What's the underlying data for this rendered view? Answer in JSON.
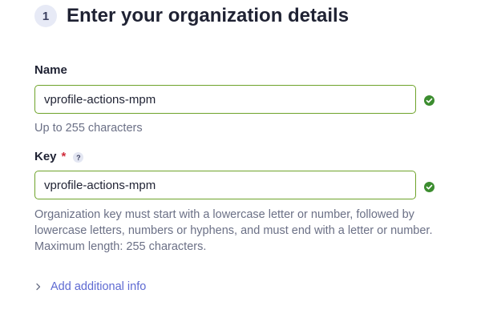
{
  "step": {
    "number": "1",
    "title": "Enter your organization details"
  },
  "name_field": {
    "label": "Name",
    "value": "vprofile-actions-mpm",
    "hint": "Up to 255 characters"
  },
  "key_field": {
    "label": "Key",
    "required_marker": "*",
    "help": "?",
    "value": "vprofile-actions-mpm",
    "hint": "Organization key must start with a lowercase letter or number, followed by lowercase letters, numbers or hyphens, and must end with a letter or number. Maximum length: 255 characters."
  },
  "additional_info": {
    "label": "Add additional info",
    "icon": "chevron-right-icon"
  },
  "colors": {
    "accent": "#5e6ad2",
    "valid": "#6ea32a",
    "valid_icon": "#3c8d2f",
    "required": "#d02b3a"
  }
}
